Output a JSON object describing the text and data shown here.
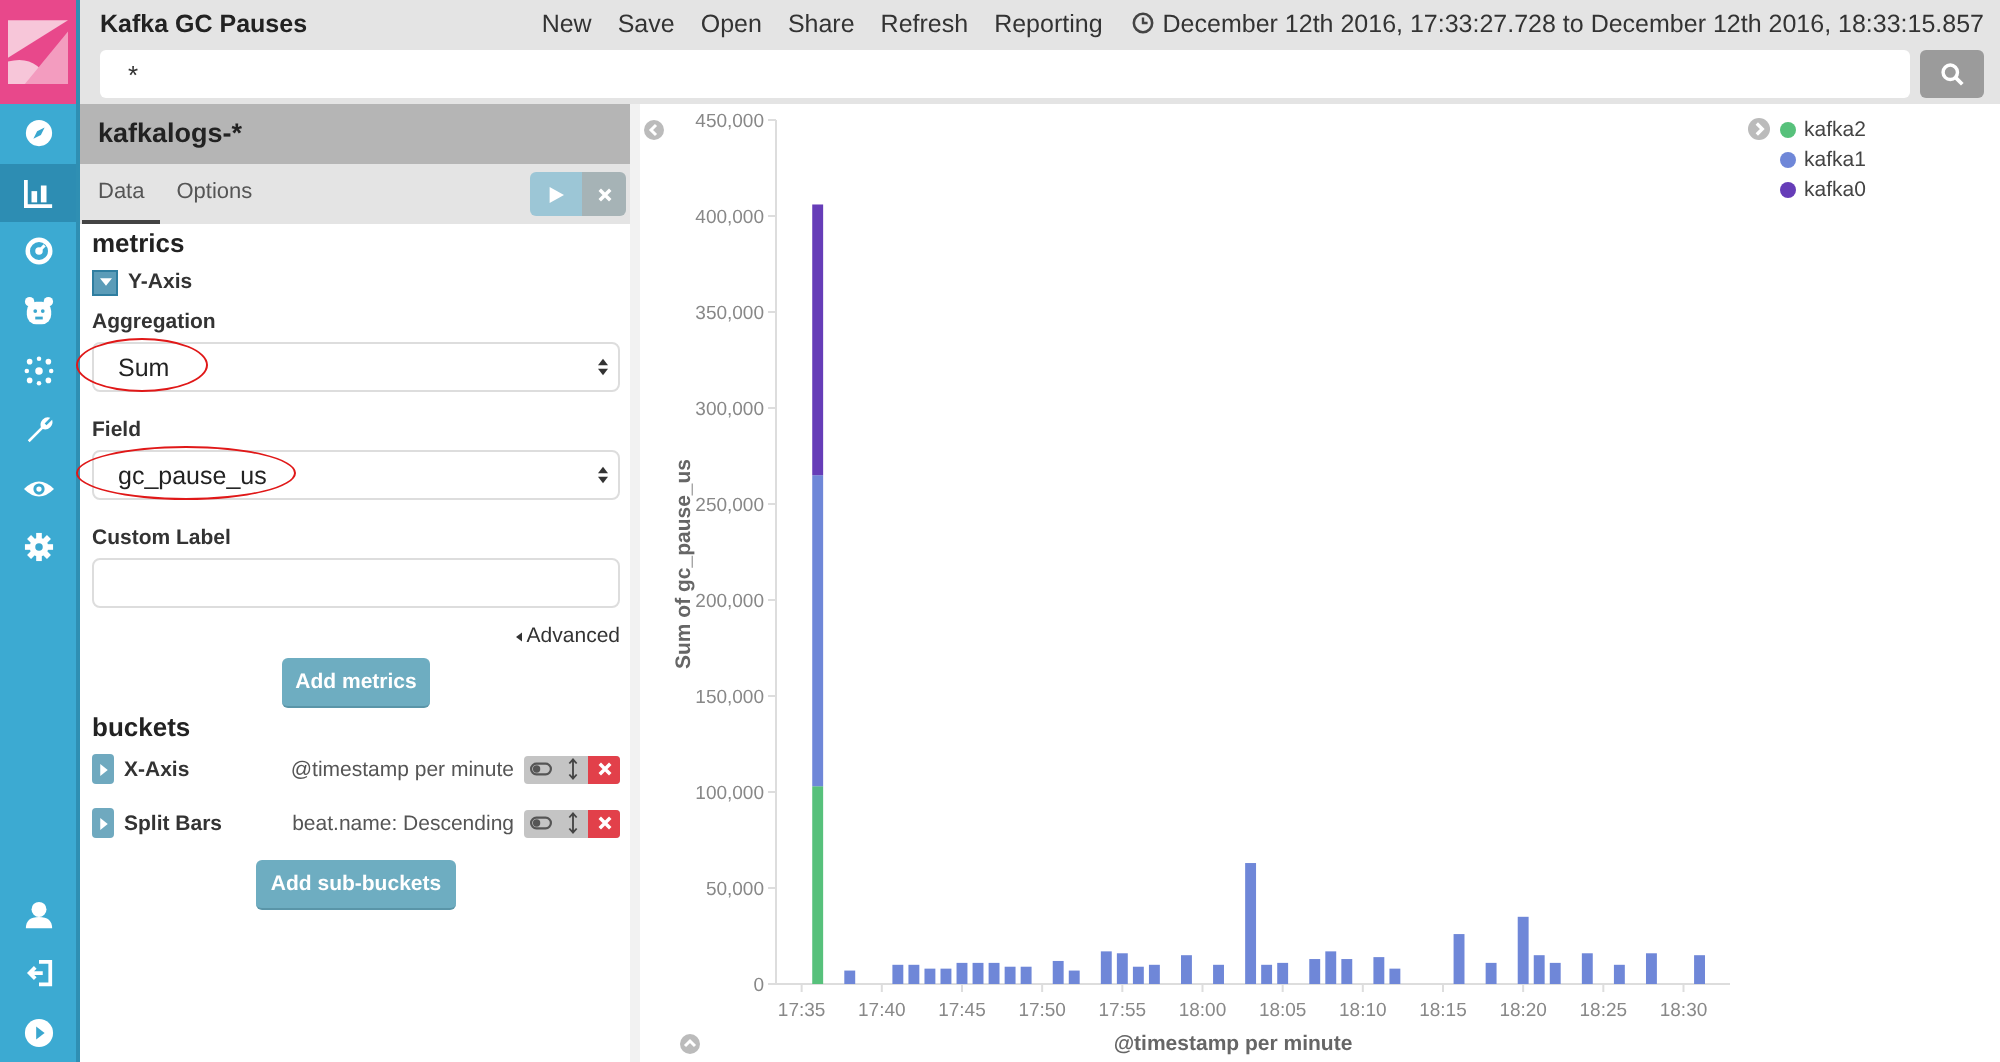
{
  "app": {
    "title": "Kafka GC Pauses",
    "menu": [
      "New",
      "Save",
      "Open",
      "Share",
      "Refresh",
      "Reporting"
    ],
    "time_range": "December 12th 2016, 17:33:27.728 to December 12th 2016, 18:33:15.857"
  },
  "search": {
    "value": "*"
  },
  "nav": [
    {
      "kind": "compass",
      "selected": false
    },
    {
      "kind": "barchart",
      "selected": true
    },
    {
      "kind": "gauge",
      "selected": false
    },
    {
      "kind": "bear",
      "selected": false
    },
    {
      "kind": "network",
      "selected": false
    },
    {
      "kind": "wrench",
      "selected": false
    },
    {
      "kind": "eye",
      "selected": false
    },
    {
      "kind": "gear",
      "selected": false
    }
  ],
  "nav_bottom": [
    {
      "kind": "user"
    },
    {
      "kind": "logout"
    },
    {
      "kind": "play"
    }
  ],
  "editor": {
    "index_pattern": "kafkalogs-*",
    "tabs": [
      {
        "label": "Data",
        "selected": true
      },
      {
        "label": "Options",
        "selected": false
      }
    ],
    "metrics_heading": "metrics",
    "metric": {
      "label": "Y-Axis",
      "aggregation_label": "Aggregation",
      "aggregation": "Sum",
      "aggregation_highlighted": true,
      "field_label": "Field",
      "field": "gc_pause_us",
      "field_highlighted": true,
      "custom_label_label": "Custom Label",
      "advanced": "Advanced"
    },
    "add_metrics": "Add metrics",
    "buckets_heading": "buckets",
    "buckets": [
      {
        "label": "X-Axis",
        "description": "@timestamp per minute"
      },
      {
        "label": "Split Bars",
        "description": "beat.name: Descending"
      }
    ],
    "add_buckets": "Add sub-buckets"
  },
  "chart": {
    "chart_data": {
      "type": "bar",
      "stacked": true,
      "ylabel": "Sum of gc_pause_us",
      "xlabel": "@timestamp per minute",
      "categories": [
        "17:35",
        null,
        null,
        null,
        null,
        "17:40",
        null,
        null,
        null,
        null,
        "17:45",
        null,
        null,
        null,
        null,
        "17:50",
        null,
        null,
        null,
        null,
        "17:55",
        null,
        null,
        null,
        null,
        "18:00",
        null,
        null,
        null,
        null,
        "18:05",
        null,
        null,
        null,
        null,
        "18:10",
        null,
        null,
        null,
        null,
        "18:15",
        null,
        null,
        null,
        null,
        "18:20",
        null,
        null,
        null,
        null,
        "18:25",
        null,
        null,
        null,
        null,
        "18:30",
        null
      ],
      "series": [
        {
          "name": "kafka2",
          "color": "#57c17b",
          "values": [
            null,
            103000,
            null,
            null,
            null,
            null,
            null,
            null,
            null,
            null,
            null,
            null,
            null,
            null,
            null,
            null,
            null,
            null,
            null,
            null,
            null,
            null,
            null,
            null,
            null,
            null,
            null,
            null,
            null,
            null,
            null,
            null,
            null,
            null,
            null,
            null,
            null,
            null,
            null,
            null,
            null,
            null,
            null,
            null,
            null,
            null,
            null,
            null,
            null,
            null,
            null,
            null,
            null,
            null,
            null,
            null,
            null
          ]
        },
        {
          "name": "kafka1",
          "color": "#6f87d8",
          "values": [
            null,
            162000,
            null,
            7000,
            null,
            null,
            10000,
            10000,
            8000,
            8000,
            11000,
            11000,
            11000,
            9000,
            9000,
            null,
            12000,
            7000,
            null,
            17000,
            16000,
            9000,
            10000,
            null,
            15000,
            null,
            10000,
            null,
            63000,
            10000,
            11000,
            null,
            13000,
            17000,
            13000,
            null,
            14000,
            8000,
            null,
            null,
            null,
            26000,
            null,
            11000,
            null,
            35000,
            15000,
            11000,
            null,
            16000,
            null,
            10000,
            null,
            16000,
            null,
            null,
            15000
          ]
        },
        {
          "name": "kafka0",
          "color": "#663db8",
          "values": [
            null,
            141000,
            null,
            null,
            null,
            null,
            null,
            null,
            null,
            null,
            null,
            null,
            null,
            null,
            null,
            null,
            null,
            null,
            null,
            null,
            null,
            null,
            null,
            null,
            null,
            null,
            null,
            null,
            null,
            null,
            null,
            null,
            null,
            null,
            null,
            null,
            null,
            null,
            null,
            null,
            null,
            null,
            null,
            null,
            null,
            null,
            null,
            null,
            null,
            null,
            null,
            null,
            null,
            null,
            null,
            null,
            null
          ]
        }
      ],
      "ylim": [
        0,
        450000
      ],
      "yticks": [
        0,
        {
          "value": 50000,
          "label": "50,000"
        },
        {
          "value": 100000,
          "label": "100,000"
        },
        {
          "value": 150000,
          "label": "150,000"
        },
        {
          "value": 200000,
          "label": "200,000"
        },
        {
          "value": 250000,
          "label": "250,000"
        },
        {
          "value": 300000,
          "label": "300,000"
        },
        {
          "value": 350000,
          "label": "350,000"
        },
        {
          "value": 400000,
          "label": "400,000"
        },
        {
          "value": 450000,
          "label": "450,000"
        }
      ]
    }
  }
}
